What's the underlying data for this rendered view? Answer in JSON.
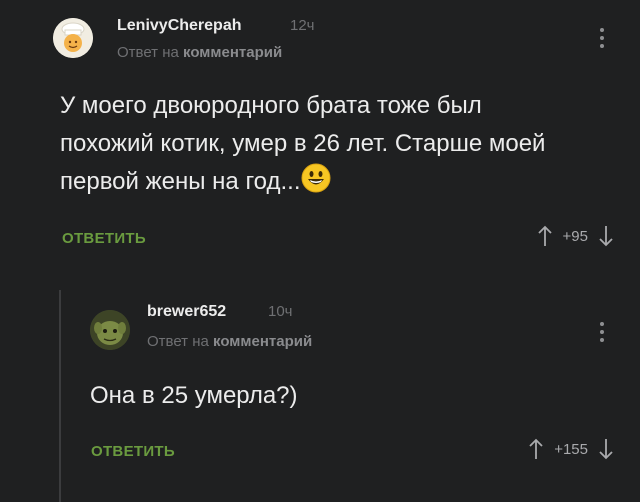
{
  "comments": [
    {
      "author": "LenivyCherepah",
      "time": "12ч",
      "reply_prefix": "Ответ на",
      "reply_target": "комментарий",
      "text": "У моего двоюродного брата тоже был похожий котик, умер в 26 лет. Старше моей первой жены на год...",
      "emoji": "grinning-face-icon",
      "reply_label": "ОТВЕТИТЬ",
      "score": "+95"
    },
    {
      "author": "brewer652",
      "time": "10ч",
      "reply_prefix": "Ответ на",
      "reply_target": "комментарий",
      "text": "Она в 25 умерла?)",
      "reply_label": "ОТВЕТИТЬ",
      "score": "+155"
    }
  ],
  "colors": {
    "background": "#1f2021",
    "accent_green": "#6a9b3f",
    "muted": "#6f7073"
  }
}
